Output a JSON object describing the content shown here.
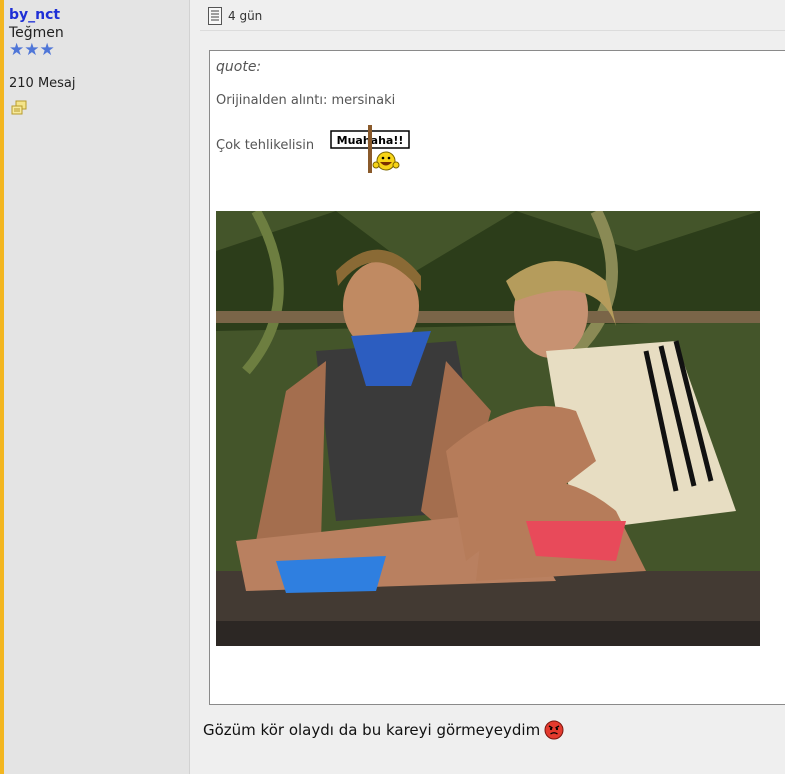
{
  "user": {
    "username": "by_nct",
    "rank": "Teğmen",
    "rank_stars": "★★★",
    "post_count": "210 Mesaj",
    "pm_icon": "private-message-icon"
  },
  "post": {
    "date": "4 gün",
    "quote": {
      "label": "quote:",
      "attribution": "Orijinalden alıntı: mersinaki",
      "text": "Çok tehlikelisin",
      "smiley_sign": "Muahaha!!"
    },
    "image_subject": "two-people-sitting-on-jungle-floor-photo",
    "message": "Gözüm kör olaydı da bu kareyi görmeyeydim",
    "message_emoji": "angry-face-icon"
  },
  "colors": {
    "username": "#1e2fd6",
    "stars": "#4f76d8",
    "accent_bar": "#f3b61f",
    "sidebar_bg": "#e4e4e4",
    "page_bg": "#efefef"
  }
}
